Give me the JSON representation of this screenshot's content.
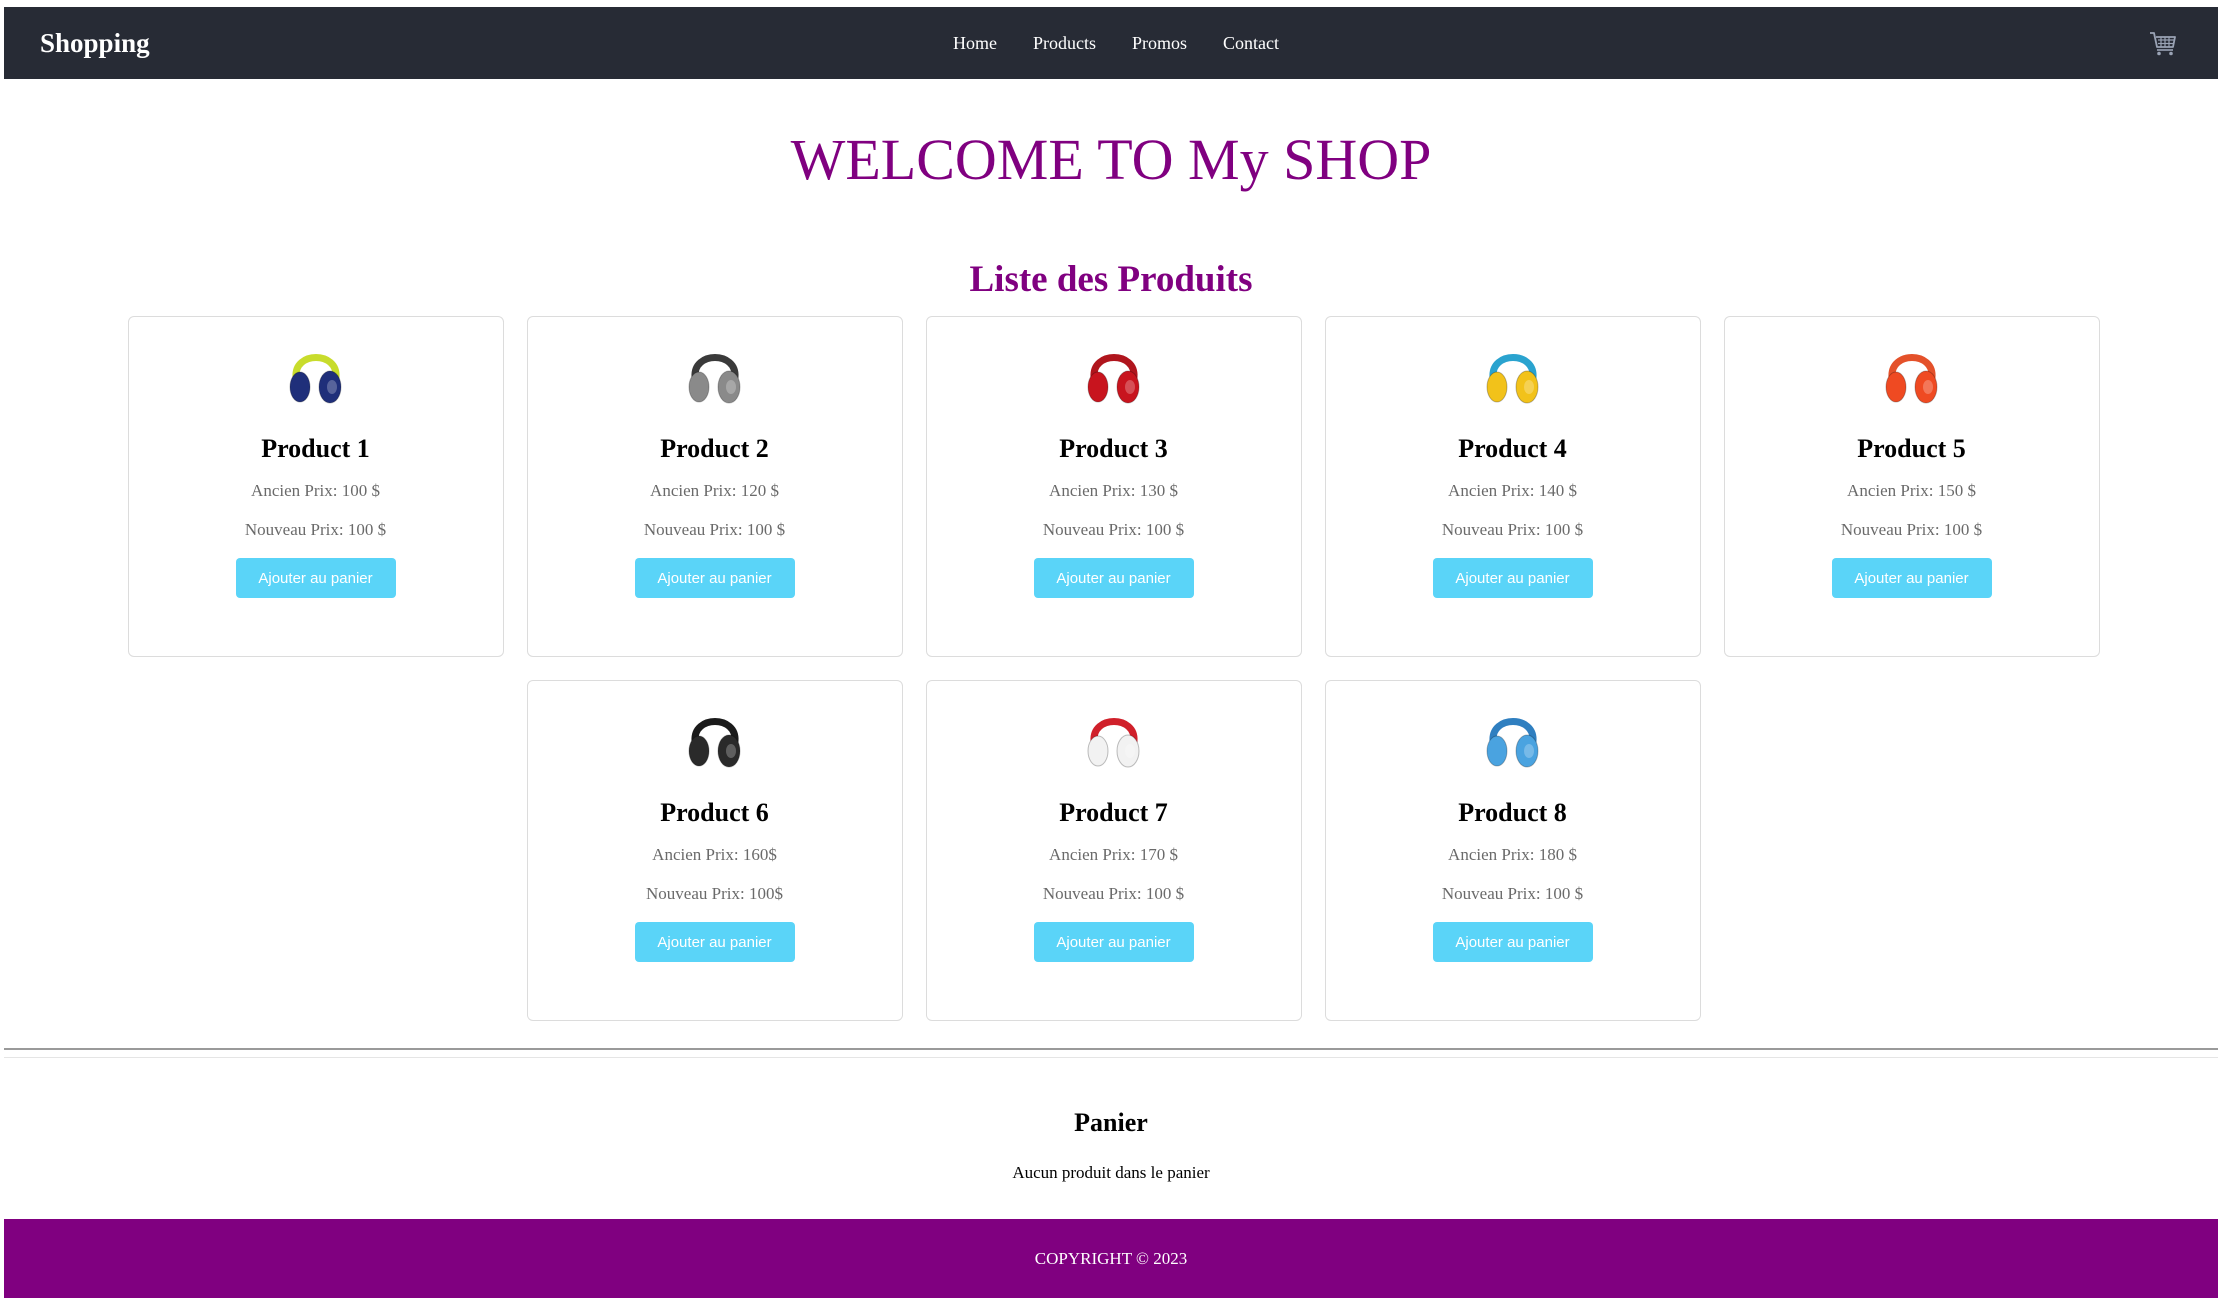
{
  "navbar": {
    "brand": "Shopping",
    "links": [
      "Home",
      "Products",
      "Promos",
      "Contact"
    ],
    "cart_icon": "shopping-cart-icon"
  },
  "hero": {
    "title": "WELCOME TO My SHOP"
  },
  "products_section": {
    "title": "Liste des Produits",
    "items": [
      {
        "name": "Product 1",
        "old_price": "Ancien Prix: 100 $",
        "new_price": "Nouveau Prix: 100 $",
        "button": "Ajouter au panier",
        "image": "headphones-icon",
        "colors": {
          "band": "#c8dc2c",
          "cup": "#1f2f7a"
        }
      },
      {
        "name": "Product 2",
        "old_price": "Ancien Prix: 120 $",
        "new_price": "Nouveau Prix: 100 $",
        "button": "Ajouter au panier",
        "image": "headphones-icon",
        "colors": {
          "band": "#3a3a3a",
          "cup": "#8a8a8a"
        }
      },
      {
        "name": "Product 3",
        "old_price": "Ancien Prix: 130 $",
        "new_price": "Nouveau Prix: 100 $",
        "button": "Ajouter au panier",
        "image": "headphones-icon",
        "colors": {
          "band": "#b0151d",
          "cup": "#c8141e"
        }
      },
      {
        "name": "Product 4",
        "old_price": "Ancien Prix: 140 $",
        "new_price": "Nouveau Prix: 100 $",
        "button": "Ajouter au panier",
        "image": "headphones-icon",
        "colors": {
          "band": "#2aa3cf",
          "cup": "#f2c21a"
        }
      },
      {
        "name": "Product 5",
        "old_price": "Ancien Prix: 150 $",
        "new_price": "Nouveau Prix: 100 $",
        "button": "Ajouter au panier",
        "image": "headphones-icon",
        "colors": {
          "band": "#e4512a",
          "cup": "#ef4a22"
        }
      },
      {
        "name": "Product 6",
        "old_price": "Ancien Prix: 160$",
        "new_price": "Nouveau Prix: 100$",
        "button": "Ajouter au panier",
        "image": "headphones-icon",
        "colors": {
          "band": "#1a1a1a",
          "cup": "#2a2a2a"
        }
      },
      {
        "name": "Product 7",
        "old_price": "Ancien Prix: 170 $",
        "new_price": "Nouveau Prix: 100 $",
        "button": "Ajouter au panier",
        "image": "headphones-icon",
        "colors": {
          "band": "#d0202a",
          "cup": "#f2f2f2"
        }
      },
      {
        "name": "Product 8",
        "old_price": "Ancien Prix: 180 $",
        "new_price": "Nouveau Prix: 100 $",
        "button": "Ajouter au panier",
        "image": "headphones-icon",
        "colors": {
          "band": "#2f7fc0",
          "cup": "#4aa3e0"
        }
      }
    ]
  },
  "cart": {
    "title": "Panier",
    "empty_message": "Aucun produit dans le panier"
  },
  "footer": {
    "text": "COPYRIGHT © 2023"
  },
  "theme": {
    "navbar_bg": "#272b35",
    "accent_purple": "#800080",
    "button_bg": "#5ad4f8"
  }
}
